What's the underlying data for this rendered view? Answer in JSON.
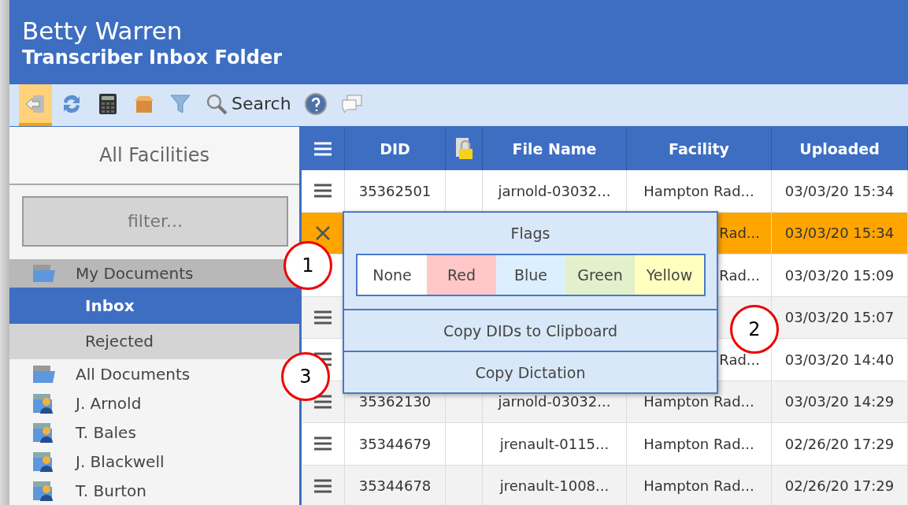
{
  "header": {
    "title": "Betty Warren",
    "subtitle": "Transcriber Inbox Folder"
  },
  "toolbar": [
    {
      "kind": "back",
      "selected": true
    },
    {
      "kind": "refresh",
      "selected": false
    },
    {
      "kind": "calculator",
      "selected": false
    },
    {
      "kind": "box",
      "selected": false
    },
    {
      "kind": "filter",
      "selected": false
    },
    {
      "kind": "search",
      "label": "Search",
      "selected": false
    },
    {
      "kind": "help",
      "selected": false
    },
    {
      "kind": "chat",
      "selected": false
    }
  ],
  "sidebar": {
    "heading": "All Facilities",
    "filter": {
      "placeholder": "filter..."
    },
    "tree": [
      {
        "label": "My Documents",
        "kind": "folder",
        "selected": false,
        "expanded": true,
        "children": [
          {
            "label": "Inbox",
            "selected": true
          },
          {
            "label": "Rejected",
            "selected": false
          }
        ]
      },
      {
        "label": "All Documents",
        "kind": "folder",
        "selected": false
      },
      {
        "label": "J. Arnold",
        "kind": "user",
        "selected": false
      },
      {
        "label": "T. Bales",
        "kind": "user",
        "selected": false
      },
      {
        "label": "J. Blackwell",
        "kind": "user",
        "selected": false
      },
      {
        "label": "T. Burton",
        "kind": "user",
        "selected": false
      }
    ]
  },
  "table": {
    "columns": [
      {
        "kind": "menu"
      },
      {
        "kind": "text",
        "label": "DID"
      },
      {
        "kind": "lock"
      },
      {
        "kind": "text",
        "label": "File Name"
      },
      {
        "kind": "text",
        "label": "Facility"
      },
      {
        "kind": "text",
        "label": "Uploaded"
      }
    ],
    "rows": [
      {
        "selected": false,
        "kind": "menu",
        "did": "35362501",
        "file": "jarnold-03032...",
        "facility": "Hampton Rad...",
        "uploaded": "03/03/20 15:34"
      },
      {
        "selected": true,
        "kind": "close",
        "facility": "Rad...",
        "uploaded": "03/03/20 15:34"
      },
      {
        "selected": false,
        "kind": "covered",
        "facility": "Rad...",
        "uploaded": "03/03/20 15:09"
      },
      {
        "selected": false,
        "kind": "menu",
        "uploaded": "03/03/20 15:07"
      },
      {
        "selected": false,
        "kind": "menu",
        "facility": "Rad...",
        "uploaded": "03/03/20 14:40"
      },
      {
        "selected": false,
        "kind": "menu",
        "did": "35362130",
        "file": "jarnold-03032...",
        "facility": "Hampton Rad...",
        "uploaded": "03/03/20 14:29"
      },
      {
        "selected": false,
        "kind": "menu",
        "did": "35344679",
        "file": "jrenault-0115...",
        "facility": "Hampton Rad...",
        "uploaded": "02/26/20 17:29"
      },
      {
        "selected": false,
        "kind": "menu",
        "did": "35344678",
        "file": "jrenault-1008...",
        "facility": "Hampton Rad...",
        "uploaded": "02/26/20 17:29"
      }
    ]
  },
  "context_menu": {
    "flags_title": "Flags",
    "flags": [
      {
        "label": "None",
        "color": "#ffffff"
      },
      {
        "label": "Red",
        "color": "#ffc7c7"
      },
      {
        "label": "Blue",
        "color": "#dcefff"
      },
      {
        "label": "Green",
        "color": "#e3f0cc"
      },
      {
        "label": "Yellow",
        "color": "#ffffc0"
      }
    ],
    "actions": [
      "Copy DIDs to Clipboard",
      "Copy Dictation"
    ]
  },
  "callouts": [
    "1",
    "2",
    "3"
  ]
}
